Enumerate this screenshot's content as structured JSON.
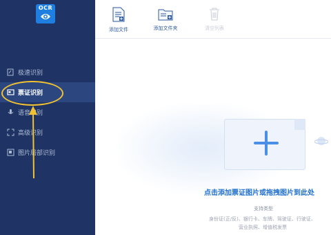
{
  "logo": {
    "text": "OCR"
  },
  "sidebar": {
    "items": [
      {
        "label": "极速识别",
        "icon": "speed-recognize-icon",
        "active": false
      },
      {
        "label": "票证识别",
        "icon": "ticket-recognize-icon",
        "active": true
      },
      {
        "label": "语音识别",
        "icon": "voice-recognize-icon",
        "active": false
      },
      {
        "label": "高级识别",
        "icon": "advanced-recognize-icon",
        "active": false
      },
      {
        "label": "图片局部识别",
        "icon": "partial-image-recognize-icon",
        "active": false
      }
    ]
  },
  "toolbar": {
    "add_file": "添加文件",
    "add_folder": "添加文件夹",
    "clear_list": "清空列表"
  },
  "dropzone": {
    "title": "点击添加票证图片或拖拽图片到此处",
    "support_label": "支持类型",
    "support_line1": "身份证(正/反)、银行卡、车牌、驾驶证、行驶证、",
    "support_line2": "营业执照、增值税发票"
  },
  "colors": {
    "sidebar_bg": "#1f3465",
    "sidebar_active_bg": "#2c4780",
    "accent": "#1e6fd0",
    "annotation": "#f1c232"
  }
}
